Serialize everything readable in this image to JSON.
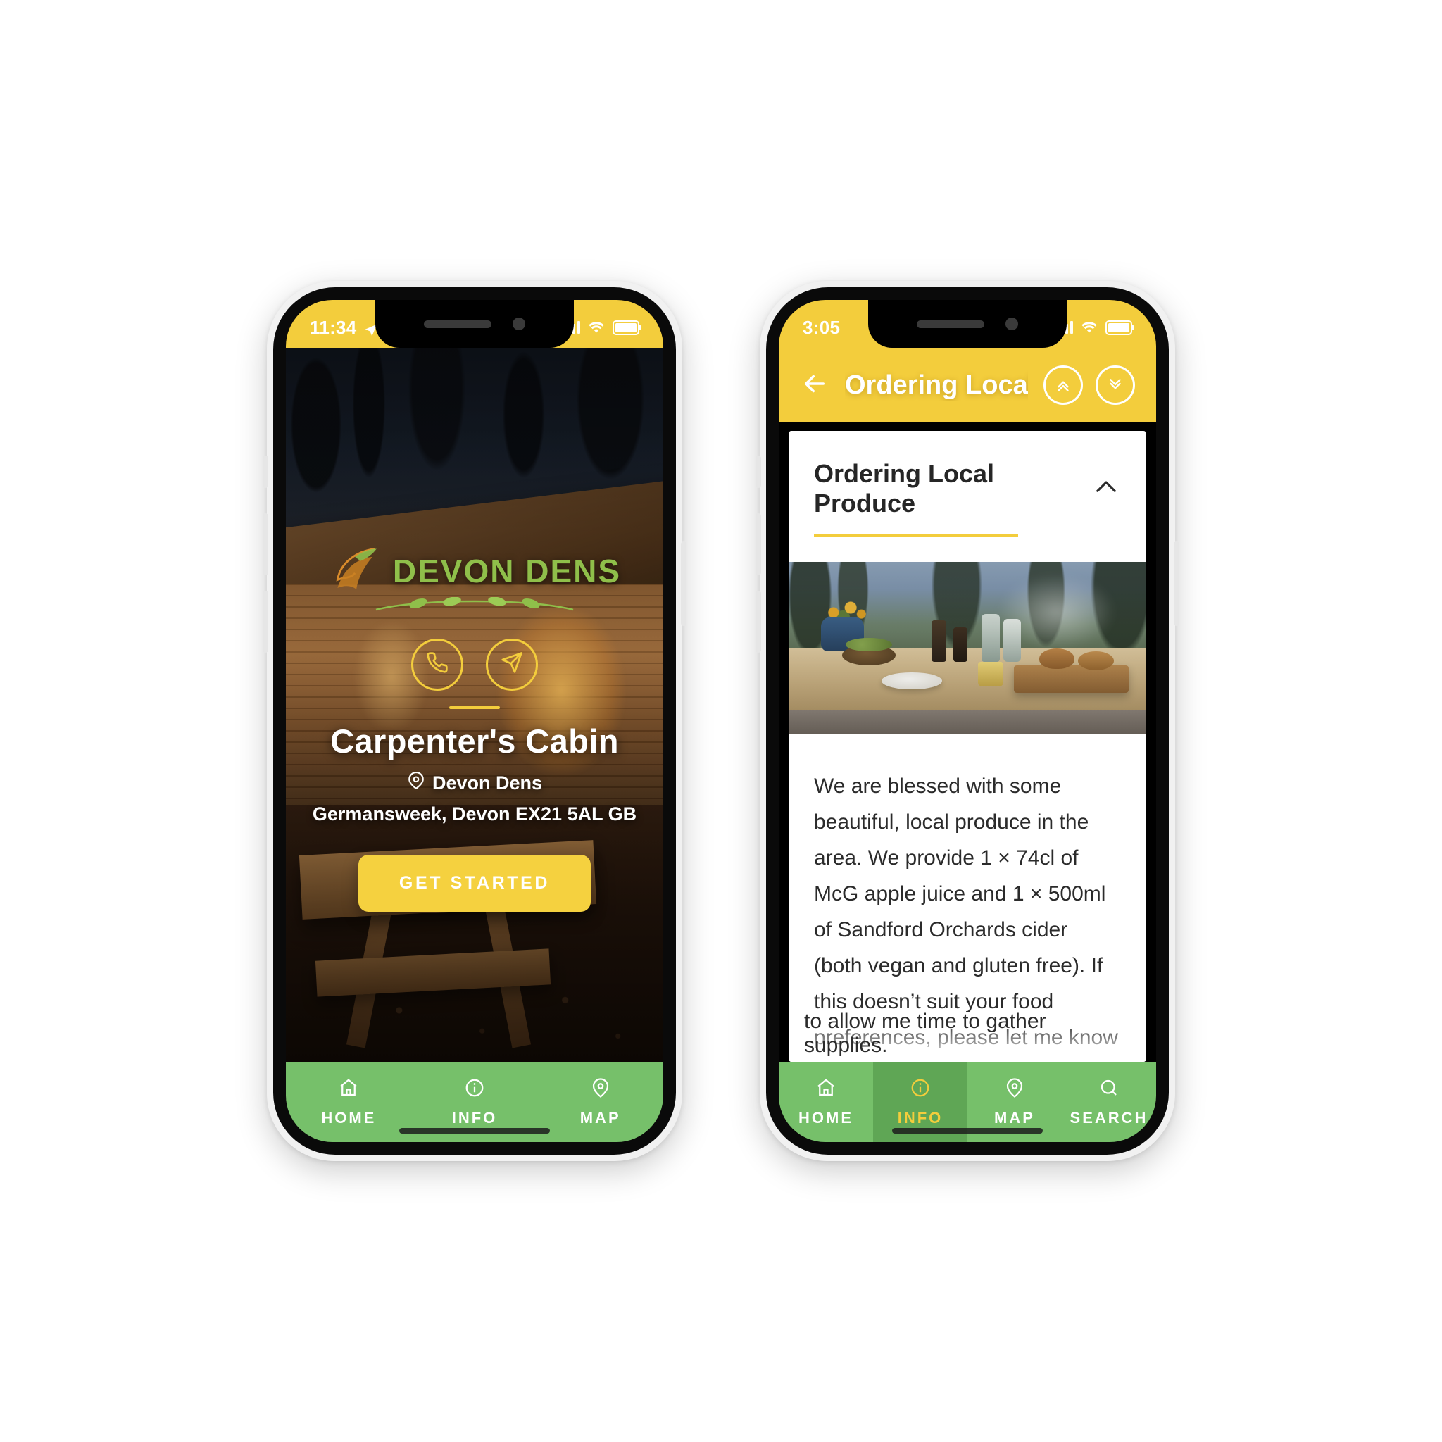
{
  "phone1": {
    "status": {
      "time": "11:34",
      "location_icon": "location-arrow-icon",
      "signal_icon": "cellular-signal-icon",
      "wifi_icon": "wifi-icon",
      "battery_icon": "battery-full-icon"
    },
    "hero": {
      "brand_name": "DEVON DENS",
      "brand_logo_icon": "leaf-swoosh-logo-icon",
      "call_icon": "phone-icon",
      "message_icon": "paper-plane-icon",
      "title": "Carpenter's Cabin",
      "location_pin_icon": "map-pin-icon",
      "location_name": "Devon Dens",
      "address": "Germansweek, Devon EX21 5AL GB",
      "cta_label": "GET STARTED"
    },
    "tabs": [
      {
        "label": "HOME",
        "icon": "home-icon",
        "active": false
      },
      {
        "label": "INFO",
        "icon": "info-icon",
        "active": false
      },
      {
        "label": "MAP",
        "icon": "map-pin-icon",
        "active": false
      }
    ]
  },
  "phone2": {
    "status": {
      "time": "3:05",
      "signal_icon": "cellular-signal-icon",
      "wifi_icon": "wifi-icon",
      "battery_icon": "battery-full-icon"
    },
    "navbar": {
      "back_icon": "arrow-left-icon",
      "title": "Ordering Local Pro...",
      "collapse_all_icon": "double-chevron-up-icon",
      "expand_all_icon": "double-chevron-down-icon"
    },
    "card": {
      "title": "Ordering Local Produce",
      "toggle_icon": "chevron-up-icon",
      "image_alt": "outdoor-table-with-local-produce",
      "body": "We are blessed with some beautiful, local produce in the area. We provide 1 × 74cl of McG apple juice and 1 × 500ml of Sandford Orchards cider (both vegan and gluten free). If this doesn’t suit your food preferences, please let me know and we can adapt it to suit. You are able to order the following, local treats in advance. I need to know at least one week before your stay",
      "body_overflow": "to allow me time to gather supplies."
    },
    "tabs": [
      {
        "label": "HOME",
        "icon": "home-icon",
        "active": false
      },
      {
        "label": "INFO",
        "icon": "info-icon",
        "active": true
      },
      {
        "label": "MAP",
        "icon": "map-pin-icon",
        "active": false
      },
      {
        "label": "SEARCH",
        "icon": "search-icon",
        "active": false
      }
    ]
  },
  "theme": {
    "yellow": "#f3cd3c",
    "cta_yellow": "#f5d13f",
    "green_tab": "#76c06a",
    "green_tab_active": "#5fa655",
    "brand_green": "#8fbf4a",
    "text_dark": "#2b2b2b"
  }
}
